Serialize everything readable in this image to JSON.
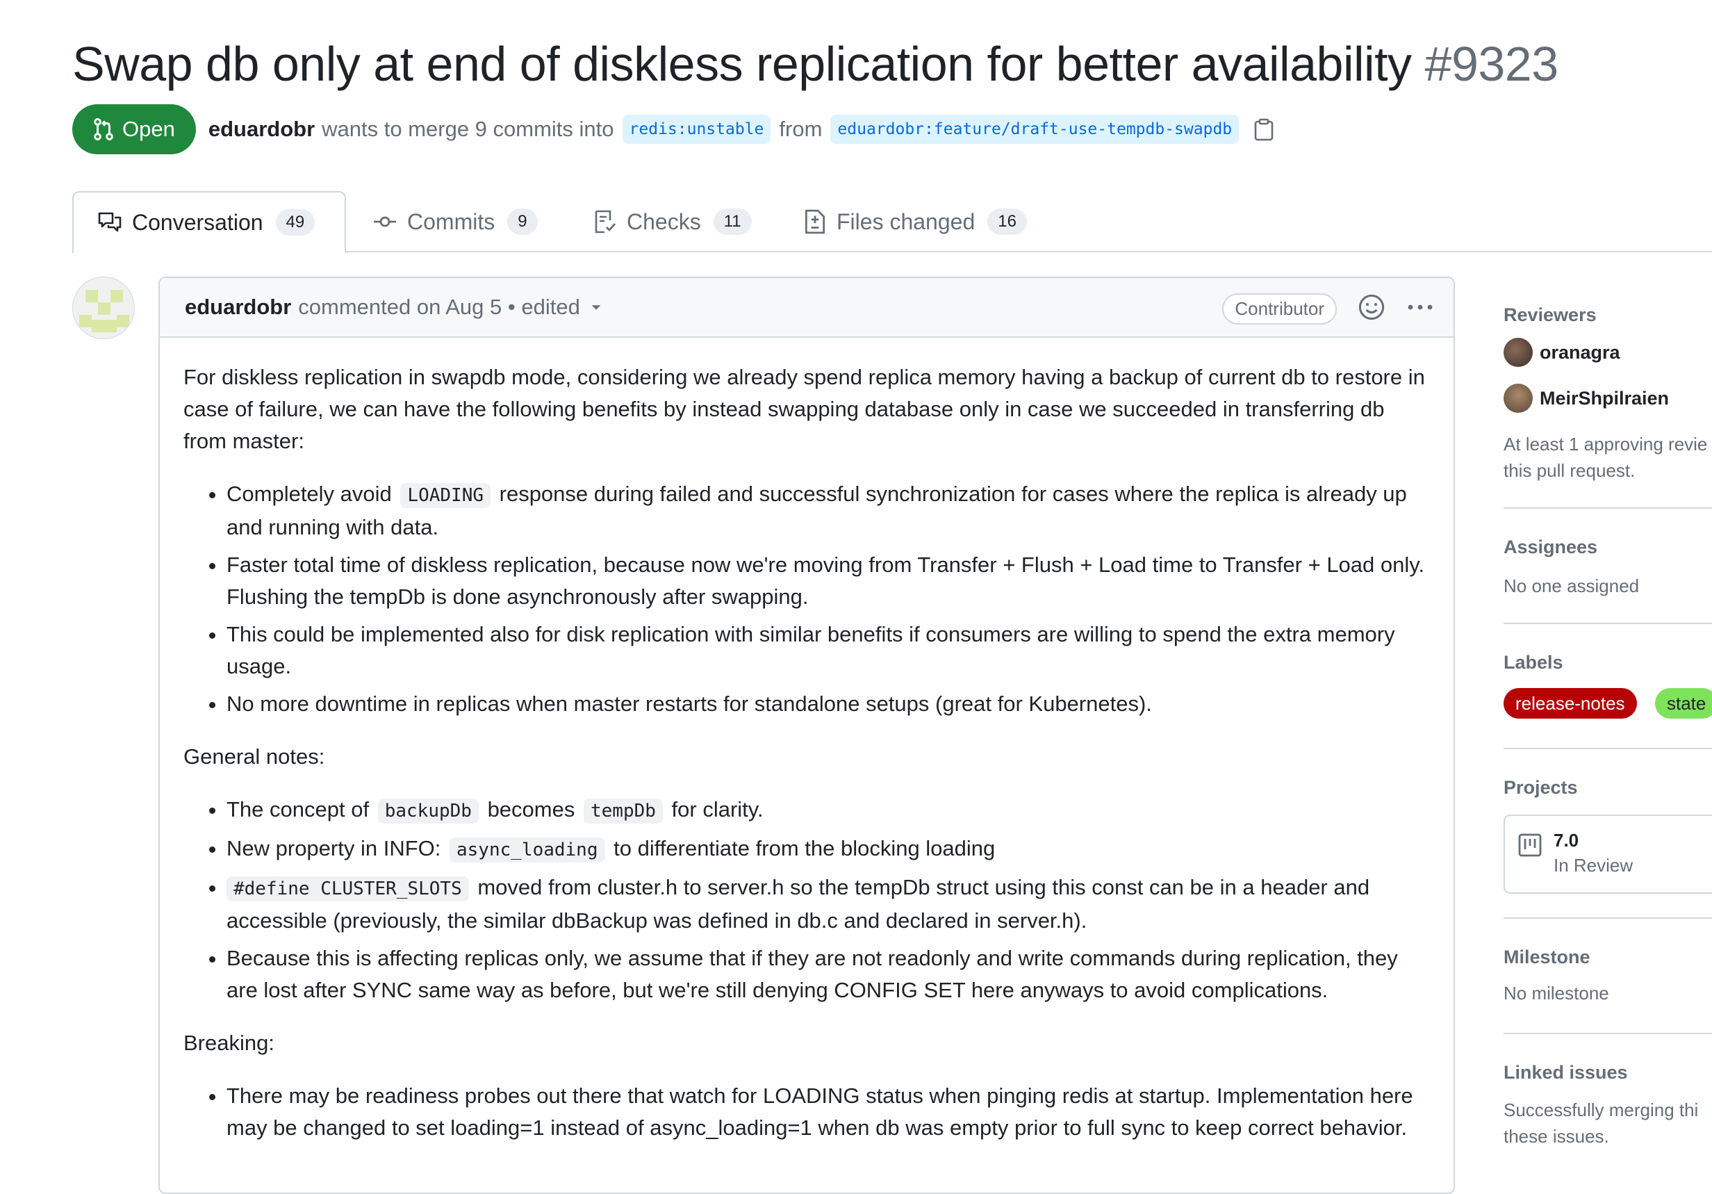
{
  "pr": {
    "title": "Swap db only at end of diskless replication for better availability",
    "number": "#9323",
    "state": "Open",
    "author": "eduardobr",
    "merge_text": "wants to merge 9 commits into",
    "base_branch": "redis:unstable",
    "from_text": "from",
    "head_branch": "eduardobr:feature/draft-use-tempdb-swapdb"
  },
  "tabs": [
    {
      "label": "Conversation",
      "count": "49",
      "icon": "comment-discussion-icon"
    },
    {
      "label": "Commits",
      "count": "9",
      "icon": "commit-icon"
    },
    {
      "label": "Checks",
      "count": "11",
      "icon": "checklist-icon"
    },
    {
      "label": "Files changed",
      "count": "16",
      "icon": "file-diff-icon"
    }
  ],
  "comment": {
    "author": "eduardobr",
    "meta": "commented on Aug 5 • edited",
    "role": "Contributor",
    "intro": "For diskless replication in swapdb mode, considering we already spend replica memory having a backup of current db to restore in case of failure, we can have the following benefits by instead swapping database only in case we succeeded in transferring db from master:",
    "benefits": {
      "b1_pre": "Completely avoid",
      "b1_code": "LOADING",
      "b1_post": "response during failed and successful synchronization for cases where the replica is already up and running with data.",
      "b2": "Faster total time of diskless replication, because now we're moving from Transfer + Flush + Load time to Transfer + Load only. Flushing the tempDb is done asynchronously after swapping.",
      "b3": "This could be implemented also for disk replication with similar benefits if consumers are willing to spend the extra memory usage.",
      "b4": "No more downtime in replicas when master restarts for standalone setups (great for Kubernetes)."
    },
    "general_heading": "General notes:",
    "notes": {
      "n1_pre": "The concept of",
      "n1_code1": "backupDb",
      "n1_mid": "becomes",
      "n1_code2": "tempDb",
      "n1_post": "for clarity.",
      "n2_pre": "New property in INFO:",
      "n2_code": "async_loading",
      "n2_post": "to differentiate from the blocking loading",
      "n3_code": "#define CLUSTER_SLOTS",
      "n3_post": "moved from cluster.h to server.h so the tempDb struct using this const can be in a header and accessible (previously, the similar dbBackup was defined in db.c and declared in server.h).",
      "n4": "Because this is affecting replicas only, we assume that if they are not readonly and write commands during replication, they are lost after SYNC same way as before, but we're still denying CONFIG SET here anyways to avoid complications."
    },
    "breaking_heading": "Breaking:",
    "breaking": {
      "k1": "There may be readiness probes out there that watch for LOADING status when pinging redis at startup. Implementation here may be changed to set loading=1 instead of async_loading=1 when db was empty prior to full sync to keep correct behavior."
    }
  },
  "sidebar": {
    "reviewers_heading": "Reviewers",
    "reviewers": [
      "oranagra",
      "MeirShpilraien"
    ],
    "reviewers_note_1": "At least 1 approving revie",
    "reviewers_note_2": "this pull request.",
    "assignees_heading": "Assignees",
    "assignees_value": "No one assigned",
    "labels_heading": "Labels",
    "labels": [
      {
        "name": "release-notes",
        "color": "#b60205",
        "text_color": "#ffffff"
      },
      {
        "name": "state",
        "color": "#7ee35b",
        "text_color": "#1f2328"
      }
    ],
    "projects_heading": "Projects",
    "project": {
      "name": "7.0",
      "status": "In Review"
    },
    "milestone_heading": "Milestone",
    "milestone_value": "No milestone",
    "linked_heading": "Linked issues",
    "linked_note_1": "Successfully merging thi",
    "linked_note_2": "these issues."
  },
  "colors": {
    "open_green": "#1f883d",
    "link_blue": "#0969da",
    "muted": "#656d76",
    "border": "#d0d7de"
  }
}
